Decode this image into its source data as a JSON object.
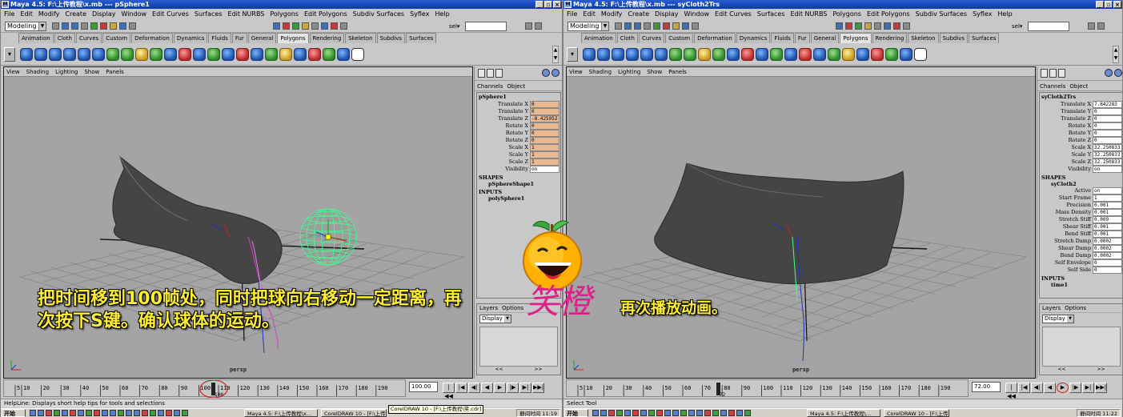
{
  "left": {
    "title": "Maya 4.5: F:\\上传教程\\x.mb  ---  pSphere1",
    "menus": [
      "File",
      "Edit",
      "Modify",
      "Create",
      "Display",
      "Window",
      "Edit Curves",
      "Surfaces",
      "Edit NURBS",
      "Polygons",
      "Edit Polygons",
      "Subdiv Surfaces",
      "Syflex",
      "Help"
    ],
    "mode": "Modeling",
    "sel_label": "sel▾",
    "shelf_tabs": [
      "Animation",
      "Cloth",
      "Curves",
      "Custom",
      "Deformation",
      "Dynamics",
      "Fluids",
      "Fur",
      "General",
      "Polygons",
      "Rendering",
      "Skeleton",
      "Subdivs",
      "Surfaces"
    ],
    "active_shelf_tab": "Polygons",
    "viewport_menus": [
      "View",
      "Shading",
      "Lighting",
      "Show",
      "Panels"
    ],
    "camera": "persp",
    "channel_menus": [
      "Channels",
      "Object"
    ],
    "object_name": "pSphere1",
    "attributes": [
      {
        "name": "Translate X",
        "value": "0"
      },
      {
        "name": "Translate Y",
        "value": "0"
      },
      {
        "name": "Translate Z",
        "value": "-8.425952"
      },
      {
        "name": "Rotate X",
        "value": "0"
      },
      {
        "name": "Rotate Y",
        "value": "0"
      },
      {
        "name": "Rotate Z",
        "value": "0"
      },
      {
        "name": "Scale X",
        "value": "1"
      },
      {
        "name": "Scale Y",
        "value": "1"
      },
      {
        "name": "Scale Z",
        "value": "1"
      },
      {
        "name": "Visibility",
        "value": "on"
      }
    ],
    "shapes_label": "SHAPES",
    "shape_name": "pSphereShape1",
    "inputs_label": "INPUTS",
    "input_name": "polySphere1",
    "layers_menus": [
      "Layers",
      "Options"
    ],
    "display_select": "Display",
    "current_frame": "100.00",
    "timeline_ticks": [
      "5",
      "10",
      "20",
      "30",
      "40",
      "50",
      "60",
      "70",
      "80",
      "90",
      "100",
      "110",
      "120",
      "130",
      "140",
      "150",
      "160",
      "170",
      "180",
      "190"
    ],
    "current_frame_marker": "100",
    "help_line": "HelpLine: Displays short help tips for tools and selections",
    "overlay_text": "把时间移到100帧处，同时把球向右移动一定距离，再次按下S键。确认球体的运动。",
    "taskbar_start": "开始",
    "taskbar_tasks": [
      "Maya 4.5: F:\\上传教程\\x...",
      "CorelDRAW 10 - [F:\\上传..."
    ],
    "tooltip": "CorelDRAW 10 - [F:\\上传教程\\笑.cdr]",
    "clock": "静间时间 11:19"
  },
  "right": {
    "title": "Maya 4.5: F:\\上传教程\\x.mb  ---  syCloth2Trs",
    "menus": [
      "File",
      "Edit",
      "Modify",
      "Create",
      "Display",
      "Window",
      "Edit Curves",
      "Surfaces",
      "Edit NURBS",
      "Polygons",
      "Edit Polygons",
      "Subdiv Surfaces",
      "Syflex",
      "Help"
    ],
    "mode": "Modeling",
    "sel_label": "sel▾",
    "shelf_tabs": [
      "Animation",
      "Cloth",
      "Curves",
      "Custom",
      "Deformation",
      "Dynamics",
      "Fluids",
      "Fur",
      "General",
      "Polygons",
      "Rendering",
      "Skeleton",
      "Subdivs",
      "Surfaces"
    ],
    "active_shelf_tab": "Polygons",
    "viewport_menus": [
      "View",
      "Shading",
      "Lighting",
      "Show",
      "Panels"
    ],
    "camera": "persp",
    "channel_menus": [
      "Channels",
      "Object"
    ],
    "object_name": "syCloth2Trs",
    "attributes": [
      {
        "name": "Translate X",
        "value": "7.842283"
      },
      {
        "name": "Translate Y",
        "value": "0"
      },
      {
        "name": "Translate Z",
        "value": "0"
      },
      {
        "name": "Rotate X",
        "value": "0"
      },
      {
        "name": "Rotate Y",
        "value": "0"
      },
      {
        "name": "Rotate Z",
        "value": "0"
      },
      {
        "name": "Scale X",
        "value": "32.250833"
      },
      {
        "name": "Scale Y",
        "value": "32.250833"
      },
      {
        "name": "Scale Z",
        "value": "32.250833"
      },
      {
        "name": "Visibility",
        "value": "on"
      }
    ],
    "shapes_label": "SHAPES",
    "shape_name": "syCloth2",
    "shape_attributes": [
      {
        "name": "Active",
        "value": "on"
      },
      {
        "name": "Start Frame",
        "value": "1"
      },
      {
        "name": "Precision",
        "value": "0.001"
      },
      {
        "name": "Mass Density",
        "value": "0.001"
      },
      {
        "name": "Stretch Stiff",
        "value": "0.009"
      },
      {
        "name": "Shear Stiff",
        "value": "0.001"
      },
      {
        "name": "Bend Stiff",
        "value": "0.001"
      },
      {
        "name": "Stretch Damp",
        "value": "0.0002"
      },
      {
        "name": "Shear Damp",
        "value": "0.0002"
      },
      {
        "name": "Bend Damp",
        "value": "0.0002"
      },
      {
        "name": "Self Envelope",
        "value": "0"
      },
      {
        "name": "Self Side",
        "value": "0"
      }
    ],
    "inputs_label": "INPUTS",
    "input_name": "time1",
    "layers_menus": [
      "Layers",
      "Options"
    ],
    "display_select": "Display",
    "current_frame": "72.00",
    "timeline_ticks": [
      "5",
      "10",
      "20",
      "30",
      "40",
      "50",
      "60",
      "70",
      "80",
      "90",
      "100",
      "110",
      "120",
      "130",
      "140",
      "150",
      "160",
      "170",
      "180",
      "190"
    ],
    "current_frame_marker": "72",
    "help_line": "Select Tool",
    "overlay_text": "再次播放动画。",
    "taskbar_start": "开始",
    "taskbar_tasks": [
      "Maya 4.5: F:\\上传教程\\...",
      "CorelDRAW 10 - [F:\\上传..."
    ],
    "clock": "静间时间 11:22"
  },
  "brand_text": "笑橙",
  "colors": {
    "title_bar": "#0a3aa8",
    "viewport": "#a4a4a4",
    "keyed_field": "#e8b890",
    "overlay_text": "#ffee33",
    "brand": "#e0208a",
    "sphere_wire": "#40ff90"
  }
}
